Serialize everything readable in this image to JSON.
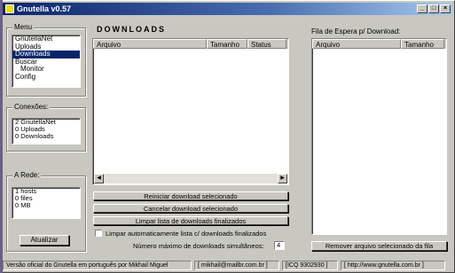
{
  "window": {
    "title": "Gnutella v0.57",
    "controls": [
      "_",
      "□",
      "×"
    ]
  },
  "menu": {
    "label": "Menu",
    "items": [
      {
        "label": "GnutellaNet",
        "selected": false,
        "indent": false
      },
      {
        "label": "Uploads",
        "selected": false,
        "indent": false
      },
      {
        "label": "Downloads",
        "selected": true,
        "indent": false
      },
      {
        "label": "Buscar",
        "selected": false,
        "indent": false
      },
      {
        "label": "Monitor",
        "selected": false,
        "indent": true
      },
      {
        "label": "Config",
        "selected": false,
        "indent": false
      }
    ]
  },
  "connections": {
    "label": "Conexões:",
    "lines": [
      "2 GnutellaNet",
      "0 Uploads",
      "0 Downloads"
    ]
  },
  "network": {
    "label": "A Rede:",
    "lines": [
      "1 hosts",
      "0 files",
      "0 MB"
    ],
    "update_button": "Atualizar"
  },
  "downloads": {
    "title": "DOWNLOADS",
    "columns": [
      "Arquivo",
      "Tamanho",
      "Status"
    ],
    "rows": [],
    "buttons": {
      "restart": "Reiniciar download selecionado",
      "cancel": "Cancelar download selecionado",
      "clear": "Limpar lista de downloads finalizados"
    },
    "auto_clear_label": "Limpar automaticamente lista c/ downloads finalizados",
    "auto_clear_checked": false,
    "max_label": "Número máximo de downloads simultâneos:",
    "max_value": "4"
  },
  "queue": {
    "title": "Fila de Espera p/ Download:",
    "columns": [
      "Arquivo",
      "Tamanho"
    ],
    "rows": [],
    "remove_button": "Remover arquivo selecionado da fila"
  },
  "statusbar": {
    "version": "Versão oficial do Gnutella em português por Mikhail Miguel",
    "email": "[ mikhail@mailbr.com.br ]",
    "icq": "[ICQ 9302930 ]",
    "site": "[ http://www.gnutella.com.br ]"
  },
  "colors": {
    "face": "#c8c8c0",
    "title_start": "#0a246a",
    "title_end": "#a6caf0",
    "selection": "#0a246a"
  }
}
